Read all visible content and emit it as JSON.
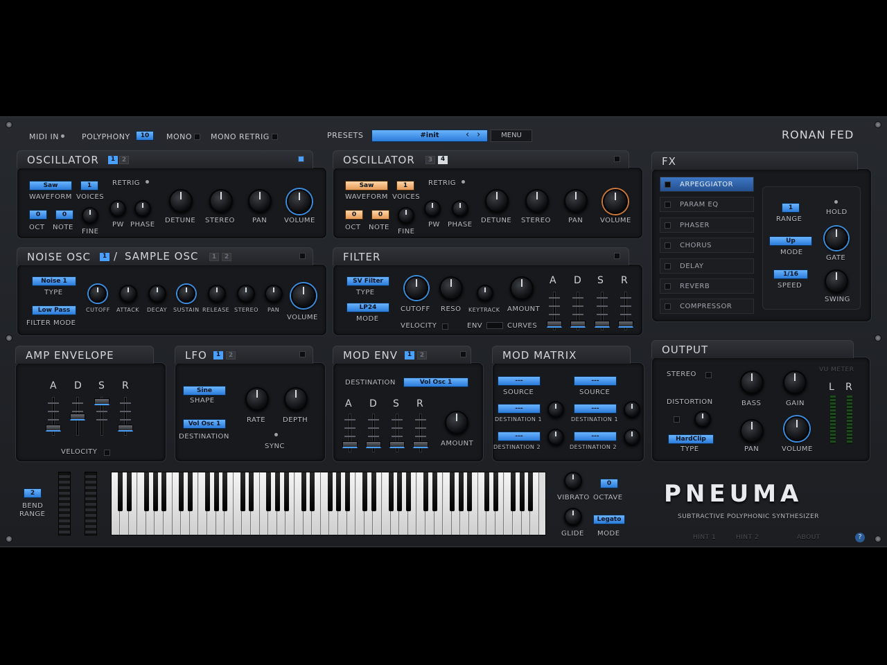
{
  "topbar": {
    "midi_in": "MIDI IN",
    "polyphony_label": "POLYPHONY",
    "polyphony_value": "10",
    "mono": "MONO",
    "mono_retrig": "MONO RETRIG",
    "presets_label": "PRESETS",
    "preset_value": "#init",
    "prev_arrow": "‹",
    "next_arrow": "›",
    "menu": "MENU",
    "brand": "RONAN FED"
  },
  "osc1": {
    "title": "OSCILLATOR",
    "tab1": "1",
    "tab2": "2",
    "waveform_value": "Saw",
    "voices_value": "1",
    "retrig": "RETRIG",
    "waveform": "WAVEFORM",
    "voices": "VOICES",
    "oct_value": "0",
    "note_value": "0",
    "oct": "OCT",
    "note": "NOTE",
    "fine": "FINE",
    "pw": "PW",
    "phase": "PHASE",
    "detune": "DETUNE",
    "stereo": "STEREO",
    "pan": "PAN",
    "volume": "VOLUME"
  },
  "osc2": {
    "title": "OSCILLATOR",
    "tab1": "3",
    "tab2": "4",
    "waveform_value": "Saw",
    "voices_value": "1",
    "retrig": "RETRIG",
    "waveform": "WAVEFORM",
    "voices": "VOICES",
    "oct_value": "0",
    "note_value": "0",
    "oct": "OCT",
    "note": "NOTE",
    "fine": "FINE",
    "pw": "PW",
    "phase": "PHASE",
    "detune": "DETUNE",
    "stereo": "STEREO",
    "pan": "PAN",
    "volume": "VOLUME"
  },
  "noise": {
    "title_a": "NOISE OSC",
    "tab_a": "1",
    "slash": "/",
    "title_b": "SAMPLE OSC",
    "tab_b1": "1",
    "tab_b2": "2",
    "type_value": "Noise 1",
    "type": "TYPE",
    "filter_value": "Low Pass",
    "filter_mode": "FILTER MODE",
    "cutoff": "CUTOFF",
    "attack": "ATTACK",
    "decay": "DECAY",
    "sustain": "SUSTAIN",
    "release": "RELEASE",
    "stereo": "STEREO",
    "pan": "PAN",
    "volume": "VOLUME"
  },
  "filter": {
    "title": "FILTER",
    "type_value": "SV Filter",
    "type": "TYPE",
    "mode_value": "LP24",
    "mode": "MODE",
    "cutoff": "CUTOFF",
    "reso": "RESO",
    "keytrack": "KEYTRACK",
    "amount": "AMOUNT",
    "velocity": "VELOCITY",
    "env": "ENV",
    "curves": "CURVES",
    "a": "A",
    "d": "D",
    "s": "S",
    "r": "R"
  },
  "fx": {
    "title": "FX",
    "items": [
      "ARPEGGIATOR",
      "PARAM EQ",
      "PHASER",
      "CHORUS",
      "DELAY",
      "REVERB",
      "COMPRESSOR"
    ],
    "range_value": "1",
    "range": "RANGE",
    "hold": "HOLD",
    "mode_value": "Up",
    "mode": "MODE",
    "gate": "GATE",
    "speed_value": "1/16",
    "speed": "SPEED",
    "swing": "SWING"
  },
  "amp": {
    "title": "AMP ENVELOPE",
    "a": "A",
    "d": "D",
    "s": "S",
    "r": "R",
    "velocity": "VELOCITY"
  },
  "lfo": {
    "title": "LFO",
    "tab1": "1",
    "tab2": "2",
    "shape_value": "Sine",
    "shape": "SHAPE",
    "rate": "RATE",
    "depth": "DEPTH",
    "dest_value": "Vol Osc 1",
    "destination": "DESTINATION",
    "sync": "SYNC"
  },
  "modenv": {
    "title": "MOD ENV",
    "tab1": "1",
    "tab2": "2",
    "destination": "DESTINATION",
    "dest_value": "Vol Osc 1",
    "a": "A",
    "d": "D",
    "s": "S",
    "r": "R",
    "amount": "AMOUNT"
  },
  "modmatrix": {
    "title": "MOD MATRIX",
    "dash": "---",
    "source": "SOURCE",
    "dest1": "DESTINATION 1",
    "dest2": "DESTINATION 2"
  },
  "output": {
    "title": "OUTPUT",
    "stereo": "STEREO",
    "distortion": "DISTORTION",
    "type_value": "HardClip",
    "type": "TYPE",
    "bass": "BASS",
    "gain": "GAIN",
    "pan": "PAN",
    "volume": "VOLUME",
    "vu_meter": "VU METER",
    "l": "L",
    "r": "R"
  },
  "bottom": {
    "bend_value": "2",
    "bend": "BEND",
    "range": "RANGE",
    "vibrato": "VIBRATO",
    "octave_value": "0",
    "octave": "OCTAVE",
    "glide": "GLIDE",
    "mode_value": "Legato",
    "mode": "MODE"
  },
  "logo": {
    "name": "PNEUMA",
    "subtitle": "SUBTRACTIVE POLYPHONIC SYNTHESIZER",
    "hint1": "HINT 1",
    "hint2": "HINT 2",
    "about": "ABOUT",
    "help": "?"
  },
  "colors": {
    "accent": "#4aa0ff",
    "osc2_accent": "#e59a56",
    "background": "#1c1e22"
  }
}
